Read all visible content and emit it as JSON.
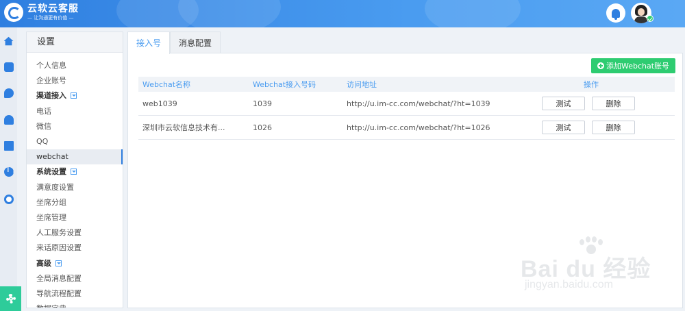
{
  "header": {
    "logo_title": "云软云客服",
    "logo_slogan": "— 让沟通更有价值 —"
  },
  "colors": {
    "primary": "#2f7fe0",
    "accent_green": "#2ecc71",
    "header_light": "#5aa8f4"
  },
  "rail": {
    "icons": [
      "home-icon",
      "phone-icon",
      "chat-icon",
      "users-icon",
      "list-icon",
      "pie-chart-icon",
      "gauge-icon"
    ],
    "bottom_icon": "gear-icon"
  },
  "sidebar": {
    "title": "设置",
    "items": [
      {
        "label": "个人信息",
        "group": false
      },
      {
        "label": "企业账号",
        "group": false
      },
      {
        "label": "渠道接入",
        "group": true
      },
      {
        "label": "电话",
        "group": false
      },
      {
        "label": "微信",
        "group": false
      },
      {
        "label": "QQ",
        "group": false
      },
      {
        "label": "webchat",
        "group": false,
        "active": true
      },
      {
        "label": "系统设置",
        "group": true
      },
      {
        "label": "满意度设置",
        "group": false
      },
      {
        "label": "坐席分组",
        "group": false
      },
      {
        "label": "坐席管理",
        "group": false
      },
      {
        "label": "人工服务设置",
        "group": false
      },
      {
        "label": "来话原因设置",
        "group": false
      },
      {
        "label": "高级",
        "group": true
      },
      {
        "label": "全局消息配置",
        "group": false
      },
      {
        "label": "导航流程配置",
        "group": false
      },
      {
        "label": "数据字典",
        "group": false
      }
    ]
  },
  "tabs": [
    {
      "label": "接入号",
      "active": true
    },
    {
      "label": "消息配置",
      "active": false
    }
  ],
  "toolbar": {
    "add_label": "添加Webchat账号"
  },
  "table": {
    "headers": [
      "Webchat名称",
      "Webchat接入号码",
      "访问地址",
      "操作"
    ],
    "rows": [
      {
        "name": "web1039",
        "number": "1039",
        "url": "http://u.im-cc.com/webchat/?ht=1039",
        "test_label": "测试",
        "delete_label": "删除"
      },
      {
        "name": "深圳市云软信息技术有...",
        "number": "1026",
        "url": "http://u.im-cc.com/webchat/?ht=1026",
        "test_label": "测试",
        "delete_label": "删除"
      }
    ]
  },
  "watermark": {
    "text": "Bai du 经验",
    "url": "jingyan.baidu.com"
  }
}
